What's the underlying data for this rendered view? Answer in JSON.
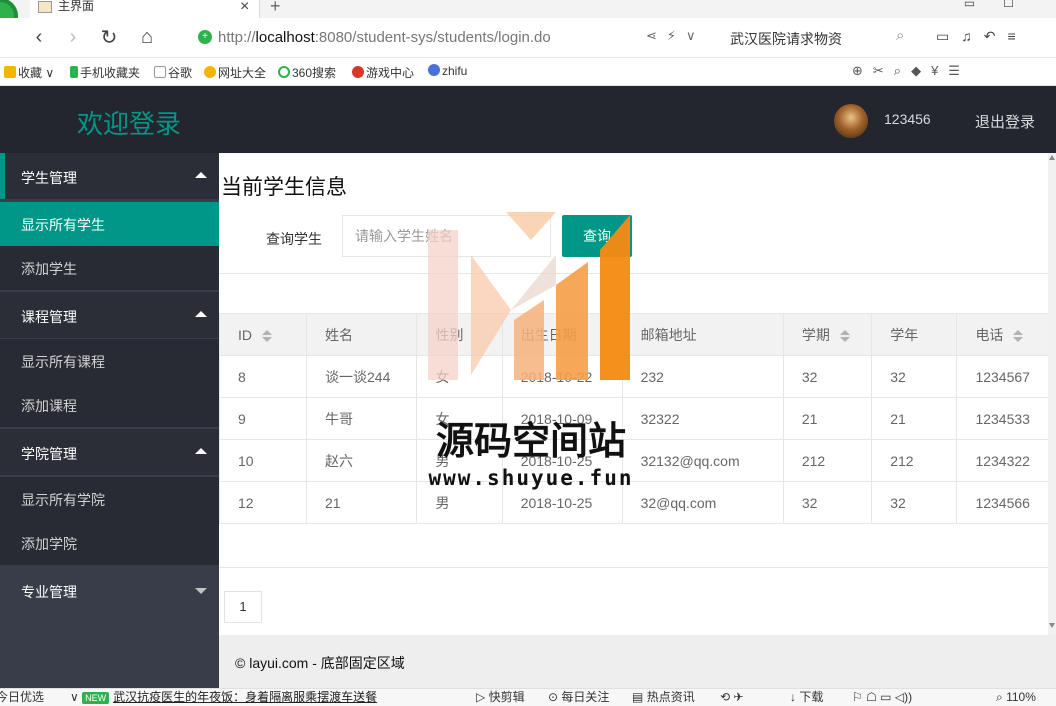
{
  "browser": {
    "tab_title": "主界面",
    "url_protocol": "http://",
    "url_host": "localhost",
    "url_rest": ":8080/student-sys/students/login.do",
    "search_box_text": "武汉医院请求物资",
    "bookmarks": [
      {
        "label": "收藏",
        "color": "#f5b400"
      },
      {
        "label": "手机收藏夹",
        "color": "#2fb14c"
      },
      {
        "label": "谷歌",
        "color": "#bbbbbb"
      },
      {
        "label": "网址大全",
        "color": "#f5b400"
      },
      {
        "label": "360搜索",
        "color": "#2fb14c"
      },
      {
        "label": "游戏中心",
        "color": "#d9352b"
      },
      {
        "label": "zhifu",
        "color": "#4a6fd6"
      }
    ]
  },
  "header": {
    "logo": "欢迎登录",
    "user_name": "123456",
    "logout": "退出登录"
  },
  "sidebar": {
    "groups": [
      {
        "label": "学生管理",
        "open": true,
        "items": [
          "显示所有学生",
          "添加学生"
        ]
      },
      {
        "label": "课程管理",
        "open": true,
        "items": [
          "显示所有课程",
          "添加课程"
        ]
      },
      {
        "label": "学院管理",
        "open": true,
        "items": [
          "显示所有学院",
          "添加学院"
        ]
      },
      {
        "label": "专业管理",
        "open": false,
        "items": []
      }
    ],
    "active_item": "显示所有学生"
  },
  "main": {
    "title": "当前学生信息",
    "search_label": "查询学生",
    "search_placeholder": "请输入学生姓名",
    "search_button": "查询",
    "table": {
      "columns": [
        {
          "label": "ID",
          "sortable": true
        },
        {
          "label": "姓名",
          "sortable": false
        },
        {
          "label": "性别",
          "sortable": false
        },
        {
          "label": "出生日期",
          "sortable": false
        },
        {
          "label": "邮箱地址",
          "sortable": false
        },
        {
          "label": "学期",
          "sortable": true
        },
        {
          "label": "学年",
          "sortable": false
        },
        {
          "label": "电话",
          "sortable": true
        }
      ],
      "rows": [
        [
          "8",
          "谈一谈244",
          "女",
          "2018-10-22",
          "232",
          "32",
          "32",
          "1234567"
        ],
        [
          "9",
          "牛哥",
          "女",
          "2018-10-09",
          "32322",
          "21",
          "21",
          "1234533"
        ],
        [
          "10",
          "赵六",
          "男",
          "2018-10-25",
          "32132@qq.com",
          "212",
          "212",
          "1234322"
        ],
        [
          "12",
          "21",
          "男",
          "2018-10-25",
          "32@qq.com",
          "32",
          "32",
          "1234566"
        ]
      ]
    },
    "pagination_current": "1"
  },
  "footer": {
    "text": "© layui.com - 底部固定区域"
  },
  "watermark": {
    "cn": "源码空间站",
    "en": "www.shuyue.fun"
  },
  "statusbar": {
    "left": "今日优选",
    "new_badge": "NEW",
    "news": "武汉抗疫医生的年夜饭：身着隔离服乘摆渡车送餐",
    "items": [
      "快剪辑",
      "每日关注",
      "热点资讯",
      "下载"
    ],
    "zoom": "110%"
  }
}
